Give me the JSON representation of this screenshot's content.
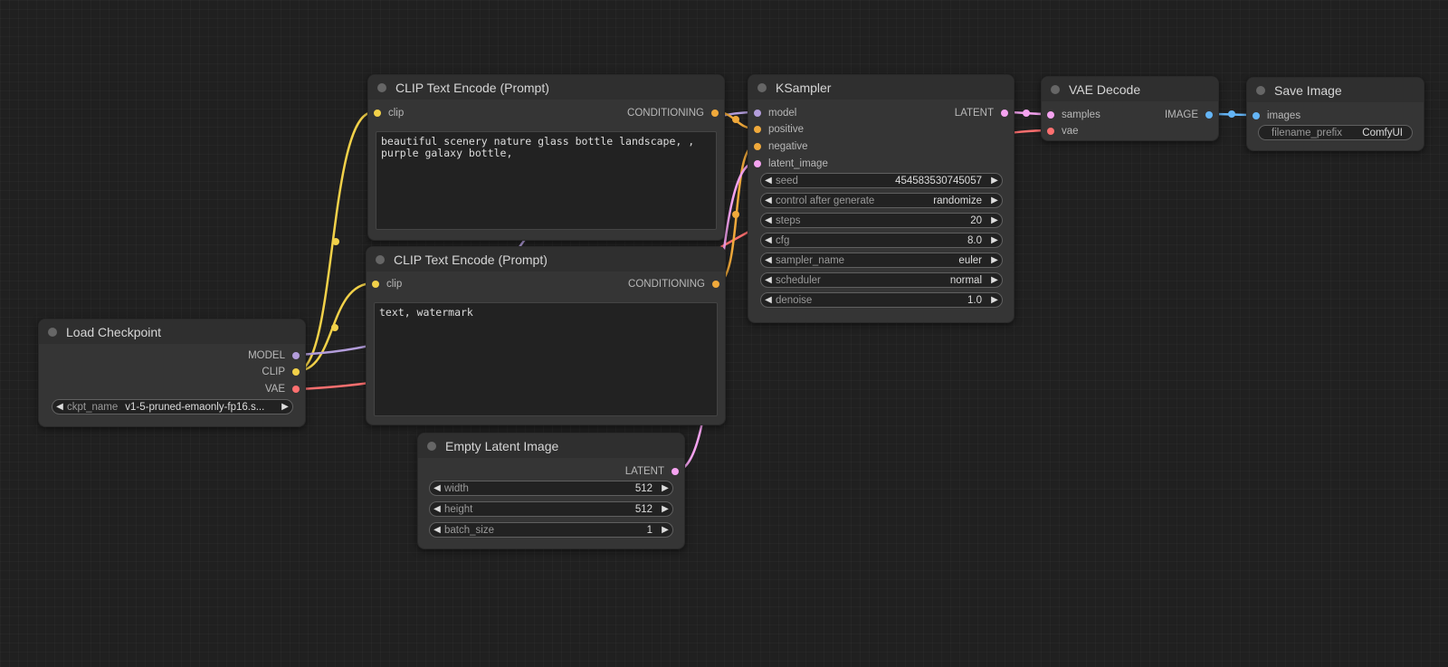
{
  "colors": {
    "model": "#b39ddb",
    "clip": "#f2d149",
    "conditioning": "#f0a93b",
    "latent": "#f5a3f0",
    "vae": "#ff7070",
    "image": "#64b5f6"
  },
  "nodes": {
    "clip_pos": {
      "title": "CLIP Text Encode (Prompt)",
      "in_clip": "clip",
      "out": "CONDITIONING",
      "text": "beautiful scenery nature glass bottle landscape, , purple galaxy bottle,"
    },
    "clip_neg": {
      "title": "CLIP Text Encode (Prompt)",
      "in_clip": "clip",
      "out": "CONDITIONING",
      "text": "text, watermark"
    },
    "checkpoint": {
      "title": "Load Checkpoint",
      "out_model": "MODEL",
      "out_clip": "CLIP",
      "out_vae": "VAE",
      "ckpt_label": "ckpt_name",
      "ckpt_value": "v1-5-pruned-emaonly-fp16.s..."
    },
    "ksampler": {
      "title": "KSampler",
      "in_model": "model",
      "in_positive": "positive",
      "in_negative": "negative",
      "in_latent": "latent_image",
      "out": "LATENT",
      "widgets": [
        {
          "label": "seed",
          "value": "454583530745057"
        },
        {
          "label": "control after generate",
          "value": "randomize"
        },
        {
          "label": "steps",
          "value": "20"
        },
        {
          "label": "cfg",
          "value": "8.0"
        },
        {
          "label": "sampler_name",
          "value": "euler"
        },
        {
          "label": "scheduler",
          "value": "normal"
        },
        {
          "label": "denoise",
          "value": "1.0"
        }
      ]
    },
    "empty_latent": {
      "title": "Empty Latent Image",
      "out": "LATENT",
      "widgets": [
        {
          "label": "width",
          "value": "512"
        },
        {
          "label": "height",
          "value": "512"
        },
        {
          "label": "batch_size",
          "value": "1"
        }
      ]
    },
    "vae_decode": {
      "title": "VAE Decode",
      "in_samples": "samples",
      "in_vae": "vae",
      "out": "IMAGE"
    },
    "save_image": {
      "title": "Save Image",
      "in_images": "images",
      "prefix_label": "filename_prefix",
      "prefix_value": "ComfyUI"
    }
  }
}
